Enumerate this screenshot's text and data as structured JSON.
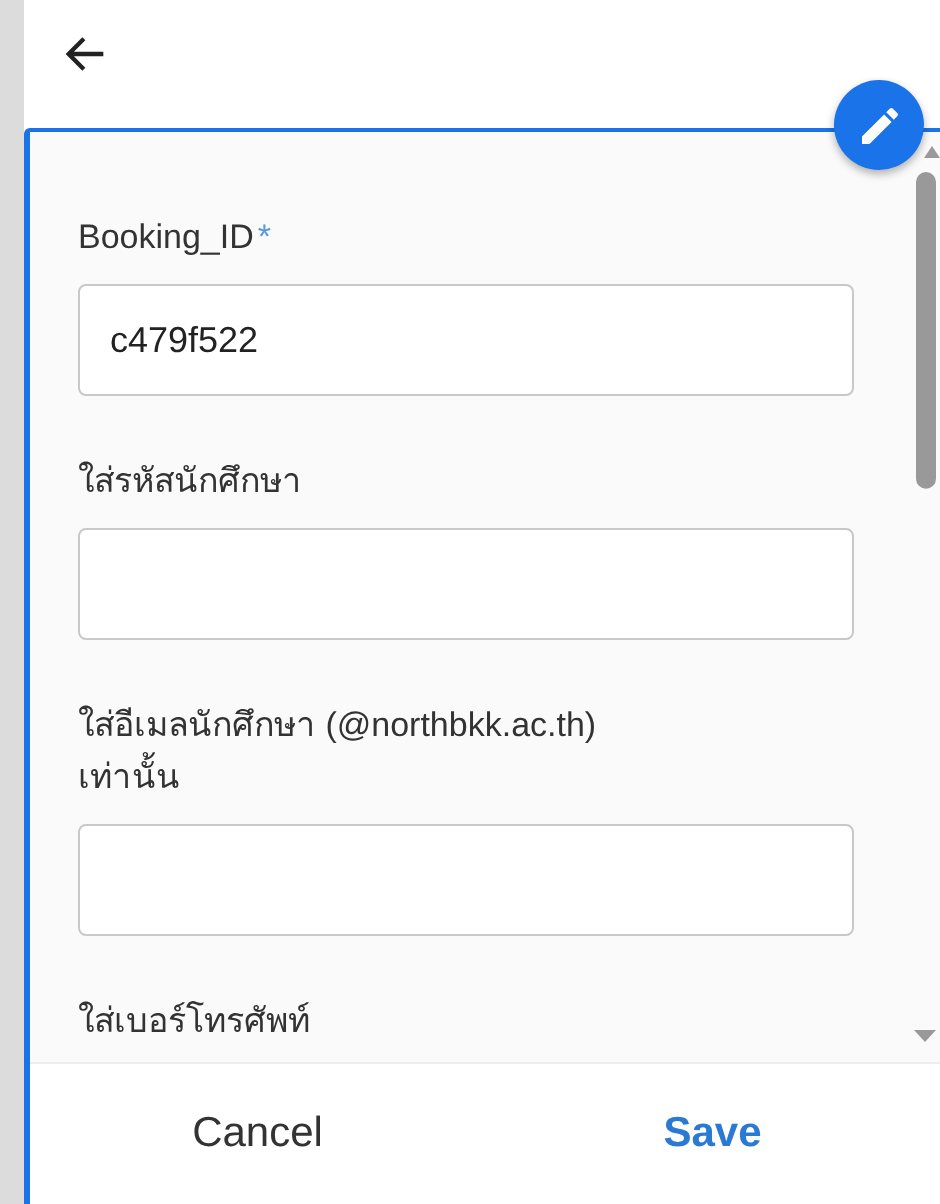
{
  "form": {
    "fields": [
      {
        "label": "Booking_ID",
        "required_mark": "*",
        "input": {
          "kind": "text",
          "value": "c479f522"
        }
      },
      {
        "label": "ใส่รหัสนักศึกษา",
        "input": {
          "kind": "text"
        }
      },
      {
        "label": "ใส่อีเมลนักศึกษา (@northbkk.ac.th) เท่านั้น",
        "input": {
          "kind": "text"
        }
      },
      {
        "label": "ใส่เบอร์โทรศัพท์"
      }
    ]
  },
  "footer": {
    "buttons": [
      {
        "label": "Cancel",
        "kind": "secondary"
      },
      {
        "label": "Save",
        "kind": "primary"
      }
    ]
  }
}
